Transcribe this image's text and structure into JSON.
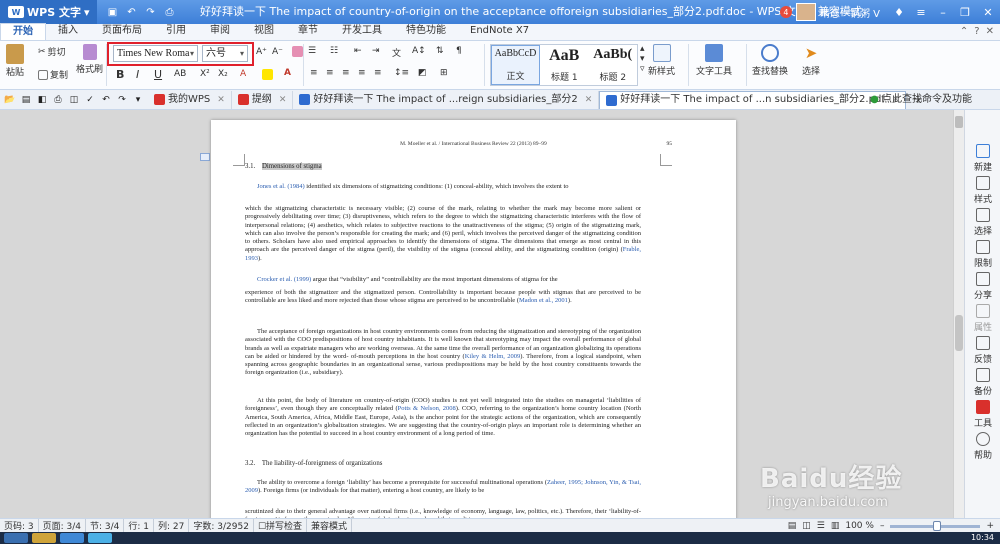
{
  "title_bar": {
    "app_name": "WPS 文字",
    "document_title": "好好拜读一下 The impact of country-of-origin on the acceptance offoreign subsidiaries_部分2.pdf.doc - WPS 文字 - 兼容模式",
    "notification_count": "4",
    "user_name": "晴恋一锅粥",
    "user_caret": "V"
  },
  "menu": {
    "tabs": [
      "开始",
      "插入",
      "页面布局",
      "引用",
      "审阅",
      "视图",
      "章节",
      "开发工具",
      "特色功能",
      "EndNote X7"
    ],
    "active_index": 0
  },
  "ribbon": {
    "paste_label": "粘贴",
    "cut_label": "剪切",
    "copy_label": "复制",
    "format_painter_label": "格式刷",
    "font_name": "Times New Roma",
    "font_size": "六号",
    "styles": [
      {
        "sample": "AaBbCcD",
        "label": "正文"
      },
      {
        "sample": "AaB",
        "label": "标题 1"
      },
      {
        "sample": "AaBb(",
        "label": "标题 2"
      }
    ],
    "new_style_label": "新样式",
    "text_tools_label": "文字工具",
    "find_replace_label": "查找替换",
    "select_label": "选择"
  },
  "doc_tabs": [
    {
      "label": "我的WPS",
      "icon_color": "#d9302c"
    },
    {
      "label": "提纲",
      "icon_color": "#d9302c"
    },
    {
      "label": "好好拜读一下 The impact of ...reign subsidiaries_部分2",
      "icon_color": "#2e6bd0"
    },
    {
      "label": "好好拜读一下 The impact of ...n subsidiaries_部分2.pdf",
      "icon_color": "#2e6bd0"
    }
  ],
  "tab_hint": "点此查找命令及功能",
  "page": {
    "header": "M. Moeller et al. / International Business Review 22 (2013) 89–99",
    "page_number": "95",
    "section_1_heading_num": "3.1.",
    "section_1_heading": "Dimensions of stigma",
    "p1_cite": "Jones et al. (1984)",
    "p1_text": " identified six dimensions of stigmatizing conditions: (1) conceal-ability, which involves the extent to",
    "p2": "which the stigmatizing characteristic is necessary visible; (2) course of the mark, relating to whether the mark may become more salient or progressively debilitating over time; (3) disruptiveness, which refers to the degree to which the stigmatizing characteristic interferes with the flow of interpersonal relations; (4) aesthetics, which relates to subjective reactions to the unattractiveness of the stigma; (5) origin of the stigmatizing mark, which can also involve the person’s responsible for    creating the mark; and (6) peril, which involves the perceived danger of the stigmatizing condition to others. Scholars have also used empirical approaches to identify the dimensions of stigma. The dimensions that emerge as most central in this approach are the perceived danger of the stigma (peril), the visibility of the stigma (conceal ability, and the stigmatizing condition (origin) (",
    "p2_cite": "Frable, 1993",
    "p2_end": ").",
    "p3_cite": "Crocker et al. (1999)",
    "p3_text": " argue that “visibility” and “controllability are the most important dimensions of stigma for the",
    "p4": "experience of both the stigmatizer and the stigmatized person. Controllability is important because people with stigmas that are perceived to be controllable are less liked and more rejected than those whose stigma are perceived  to be uncontrollable   (",
    "p4_cite": "Madon et al., 2001",
    "p4_end": ").",
    "p5": "The acceptance of foreign organizations in host country environments comes from reducing the stigmatization    and stereotyping of the organization associated with the COO predispositions of host country inhabitants. It is well known that stereotyping may impact the overall performance of global brands  as well as expatriate managers who are working overseas.      At the same time the overall performance of an organization globalizing its operations can be aided or hindered by the word- of-mouth perceptions in the host country (",
    "p5_cite": "Kiley & Helm, 2009",
    "p5_end": "). Therefore, from a logical standpoint, when spanning across geographic boundaries  in an organizational sense, various predispositions may be held by the host country constituents        towards the foreign organization (i.e., subsidiary).",
    "p6_a": "At this point, the body of literature on country-of-origin (COO) studies is not yet well integrated into the studies on managerial ‘liabilities of foreignness’, even though they are conceptually related (",
    "p6_cite": "Potts & Nelson, 2008",
    "p6_b": "). COO, referring to the organization’s home country location (North America, South America, Africa, Middle East, Europe, Asia), is the anchor point for the strategic actions of the organization, which are consequently reflected in an organization’s globalization strategies.        We    are suggesting  that  the  country-of-origin  plays  an  important  role  is  determining  whether  an  organization  has the potential to succeed in a host country environment of a long period of time.",
    "section_2_heading_num": "3.2.",
    "section_2_heading": "The liability-of-foreignness of organizations",
    "p7_a": "The ability to overcome a foreign ‘liability’ has become a prerequisite for successful multinational operations (",
    "p7_cite": "Zaheer, 1995; Johnson, Yin, & Tsai, 2009",
    "p7_b": "). Foreign firms (or individuals for that matter), entering a host country, are likely to be",
    "p8": "scrutinized due to their general advantage over national firms (i.e., knowledge of economy, language, law, politics, etc.). Therefore, their ‘liability-of-foreignness’ is frequently conceived as “the costs of doing business abroad that result in"
  },
  "right_panel": [
    {
      "label": "新建",
      "icon": "plus-icon"
    },
    {
      "label": "样式",
      "icon": "style-icon"
    },
    {
      "label": "选择",
      "icon": "cursor-icon"
    },
    {
      "label": "限制",
      "icon": "restrict-icon"
    },
    {
      "label": "分享",
      "icon": "share-icon"
    },
    {
      "label": "属性",
      "icon": "properties-icon"
    },
    {
      "label": "反馈",
      "icon": "feedback-icon"
    },
    {
      "label": "备份",
      "icon": "backup-icon"
    },
    {
      "label": "工具",
      "icon": "tools-icon"
    },
    {
      "label": "帮助",
      "icon": "help-icon"
    }
  ],
  "status_bar": {
    "page": "页码: 3",
    "pages": "页面: 3/4",
    "section": "节: 3/4",
    "row": "行: 1",
    "col": "列: 27",
    "words": "字数: 3/2952",
    "spell": "拼写检查",
    "mode": "兼容模式",
    "zoom": "100 %",
    "zoom_level": 0.52
  },
  "watermark": {
    "main": "Baidu经验",
    "sub": "jingyan.baidu.com"
  },
  "clock": "10:34",
  "colors": {
    "accent": "#3d7fd8",
    "highlight_box": "#e0202c",
    "link": "#2a5db0"
  }
}
